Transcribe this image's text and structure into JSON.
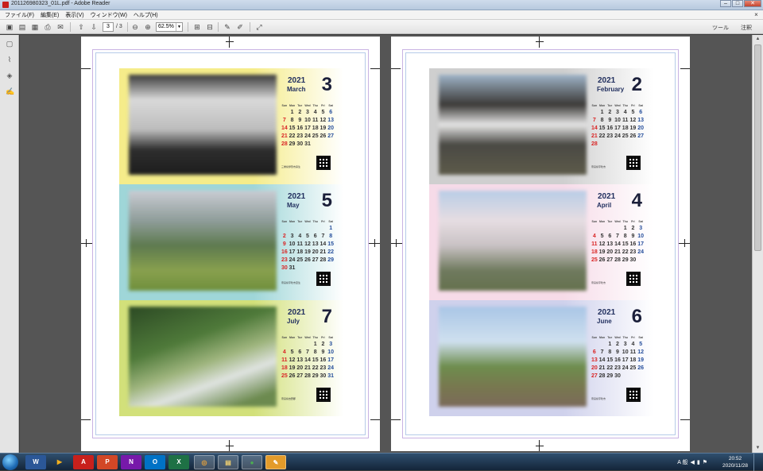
{
  "window": {
    "title": "201126980323_01L.pdf - Adobe Reader",
    "buttons": {
      "minimize": "–",
      "maximize": "□",
      "close": "✕"
    }
  },
  "menu": {
    "items": [
      "ファイル(F)",
      "編集(E)",
      "表示(V)",
      "ウィンドウ(W)",
      "ヘルプ(H)"
    ],
    "close": "×"
  },
  "toolbar": {
    "page_current": "3",
    "page_total": "/ 3",
    "zoom": "62.5%",
    "tools_label": "ツール",
    "comment_label": "注釈"
  },
  "calendar_header": [
    "Sun",
    "Mon",
    "Tue",
    "Wed",
    "Thu",
    "Fri",
    "Sat"
  ],
  "left_page": {
    "cards": [
      {
        "year": "2021",
        "month_name": "March",
        "month_num": "3",
        "bg": "#f5ec8a",
        "rows": [
          [
            "",
            "1",
            "2",
            "3",
            "4",
            "5",
            "6"
          ],
          [
            "7",
            "8",
            "9",
            "10",
            "11",
            "12",
            "13"
          ],
          [
            "14",
            "15",
            "16",
            "17",
            "18",
            "19",
            "20"
          ],
          [
            "21",
            "22",
            "23",
            "24",
            "25",
            "26",
            "27"
          ],
          [
            "28",
            "29",
            "30",
            "31",
            "",
            "",
            ""
          ]
        ],
        "note": "三重県伊賀市霧生"
      },
      {
        "year": "2021",
        "month_name": "May",
        "month_num": "5",
        "bg": "#9fd6d8",
        "rows": [
          [
            "",
            "",
            "",
            "",
            "",
            "",
            "1"
          ],
          [
            "2",
            "3",
            "4",
            "5",
            "6",
            "7",
            "8"
          ],
          [
            "9",
            "10",
            "11",
            "12",
            "13",
            "14",
            "15"
          ],
          [
            "16",
            "17",
            "18",
            "19",
            "20",
            "21",
            "22"
          ],
          [
            "23",
            "24",
            "25",
            "26",
            "27",
            "28",
            "29"
          ],
          [
            "30",
            "31",
            "",
            "",
            "",
            "",
            ""
          ]
        ],
        "note": "奈良県宇陀市室生"
      },
      {
        "year": "2021",
        "month_name": "July",
        "month_num": "7",
        "bg": "#d2e07a",
        "rows": [
          [
            "",
            "",
            "",
            "",
            "1",
            "2",
            "3"
          ],
          [
            "4",
            "5",
            "6",
            "7",
            "8",
            "9",
            "10"
          ],
          [
            "11",
            "12",
            "13",
            "14",
            "15",
            "16",
            "17"
          ],
          [
            "18",
            "19",
            "20",
            "21",
            "22",
            "23",
            "24"
          ],
          [
            "25",
            "26",
            "27",
            "28",
            "29",
            "30",
            "31"
          ]
        ],
        "note": "奈良県吉野郡"
      }
    ]
  },
  "right_page": {
    "cards": [
      {
        "year": "2021",
        "month_name": "February",
        "month_num": "2",
        "bg": "#cfcfcf",
        "rows": [
          [
            "",
            "1",
            "2",
            "3",
            "4",
            "5",
            "6"
          ],
          [
            "7",
            "8",
            "9",
            "10",
            "11",
            "12",
            "13"
          ],
          [
            "14",
            "15",
            "16",
            "17",
            "18",
            "19",
            "20"
          ],
          [
            "21",
            "22",
            "23",
            "24",
            "25",
            "26",
            "27"
          ],
          [
            "28",
            "",
            "",
            "",
            "",
            "",
            ""
          ]
        ],
        "note": "奈良県宇陀市"
      },
      {
        "year": "2021",
        "month_name": "April",
        "month_num": "4",
        "bg": "#f6dbe8",
        "rows": [
          [
            "",
            "",
            "",
            "",
            "1",
            "2",
            "3"
          ],
          [
            "4",
            "5",
            "6",
            "7",
            "8",
            "9",
            "10"
          ],
          [
            "11",
            "12",
            "13",
            "14",
            "15",
            "16",
            "17"
          ],
          [
            "18",
            "19",
            "20",
            "21",
            "22",
            "23",
            "24"
          ],
          [
            "25",
            "26",
            "27",
            "28",
            "29",
            "30",
            ""
          ]
        ],
        "note": "奈良県宇陀市"
      },
      {
        "year": "2021",
        "month_name": "June",
        "month_num": "6",
        "bg": "#cfd1ec",
        "rows": [
          [
            "",
            "",
            "1",
            "2",
            "3",
            "4",
            "5"
          ],
          [
            "6",
            "7",
            "8",
            "9",
            "10",
            "11",
            "12"
          ],
          [
            "13",
            "14",
            "15",
            "16",
            "17",
            "18",
            "19"
          ],
          [
            "20",
            "21",
            "22",
            "23",
            "24",
            "25",
            "26"
          ],
          [
            "27",
            "28",
            "29",
            "30",
            "",
            "",
            ""
          ]
        ],
        "note": "奈良県宇陀市"
      }
    ]
  },
  "taskbar": {
    "apps": [
      "W",
      "▶",
      "A",
      "P",
      "N",
      "O",
      "X",
      "◎",
      "▤",
      "●",
      "✎"
    ],
    "ime": "A 般",
    "time": "20:52",
    "date": "2020/11/28"
  },
  "colors": {
    "sunday": "#d92525",
    "saturday": "#254e9c",
    "title_bar": "#b7c9de"
  }
}
